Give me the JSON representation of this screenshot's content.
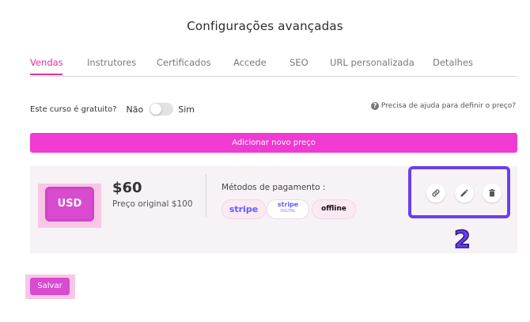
{
  "page": {
    "title": "Configurações avançadas"
  },
  "tabs": [
    {
      "label": "Vendas",
      "active": true
    },
    {
      "label": "Instrutores"
    },
    {
      "label": "Certificados"
    },
    {
      "label": "Accede"
    },
    {
      "label": "SEO"
    },
    {
      "label": "URL personalizada"
    },
    {
      "label": "Detalhes"
    }
  ],
  "free_course": {
    "question": "Este curso é gratuito?",
    "no_label": "Não",
    "yes_label": "Sim",
    "toggle_on": false
  },
  "help": {
    "text": "Precisa de ajuda para definir o preço?"
  },
  "add_price": {
    "label": "Adicionar novo preço"
  },
  "price_card": {
    "currency": "USD",
    "amount": "$60",
    "original": "Preço original $100",
    "payment_label": "Métodos de pagamento :",
    "methods": [
      "stripe",
      "stripe",
      "offline"
    ],
    "method_stripe2_sub": "DIGITAL"
  },
  "actions": {
    "icons": [
      "link-icon",
      "pencil-icon",
      "trash-icon"
    ]
  },
  "annotation": {
    "number": "2"
  },
  "save": {
    "label": "Salvar"
  },
  "colors": {
    "accent": "#f03ad2",
    "tab_active": "#e0339a",
    "annotation": "#6a3ff0",
    "stripe": "#635bff"
  }
}
